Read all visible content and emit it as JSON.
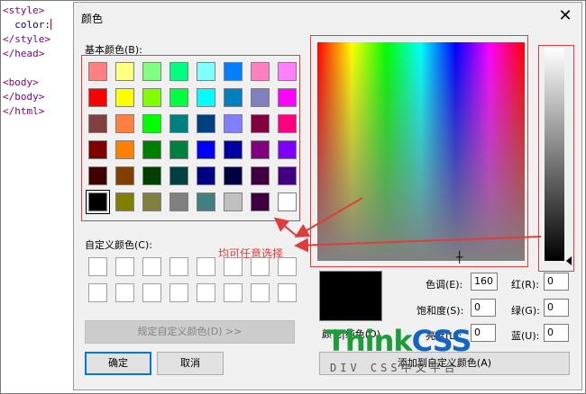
{
  "editor": {
    "lines": [
      "<style>",
      "  color:",
      "</style>",
      "</head>",
      "",
      "<body>",
      "</body>",
      "</html>"
    ]
  },
  "dialog": {
    "title": "颜色",
    "close_glyph": "✕",
    "basic_colors_label": "基本颜色(B):",
    "basic_colors": [
      [
        "#ff8080",
        "#ffff80",
        "#80ff80",
        "#00ff80",
        "#80ffff",
        "#0080ff",
        "#ff80c0",
        "#ff80ff"
      ],
      [
        "#ff0000",
        "#ffff00",
        "#80ff00",
        "#00ff40",
        "#00ffff",
        "#0080c0",
        "#8080c0",
        "#ff00ff"
      ],
      [
        "#804040",
        "#ff8040",
        "#00ff00",
        "#008080",
        "#004080",
        "#8080ff",
        "#800040",
        "#ff0080"
      ],
      [
        "#800000",
        "#ff8000",
        "#008000",
        "#008040",
        "#0000ff",
        "#0000a0",
        "#800080",
        "#8000ff"
      ],
      [
        "#400000",
        "#804000",
        "#004000",
        "#004040",
        "#000080",
        "#000040",
        "#400040",
        "#400080"
      ],
      [
        "#000000",
        "#808000",
        "#808040",
        "#808080",
        "#408080",
        "#c0c0c0",
        "#400040",
        "#ffffff"
      ]
    ],
    "selected_basic": "#000000",
    "custom_colors_label": "自定义颜色(C):",
    "custom_color_rows": 2,
    "custom_color_cols": 8,
    "annotation": "均可任意选择",
    "define_custom_label": "规定自定义颜色(D) >>",
    "ok_label": "确定",
    "cancel_label": "取消",
    "preview_label": "颜色|纯色(O)",
    "preview_color": "#000000",
    "hue_label": "色调(E):",
    "hue_value": "160",
    "sat_label": "饱和度(S):",
    "sat_value": "0",
    "lum_label": "亮度(L):",
    "lum_value": "0",
    "red_label": "红(R):",
    "red_value": "0",
    "green_label": "绿(G):",
    "green_value": "0",
    "blue_label": "蓝(U):",
    "blue_value": "0",
    "add_custom_label": "添加到自定义颜色(A)",
    "annotation_color": "#e03c3c"
  },
  "watermark": {
    "part1": "Think",
    "part2": "CSS",
    "subtitle": "DIV CSS中文平台"
  }
}
